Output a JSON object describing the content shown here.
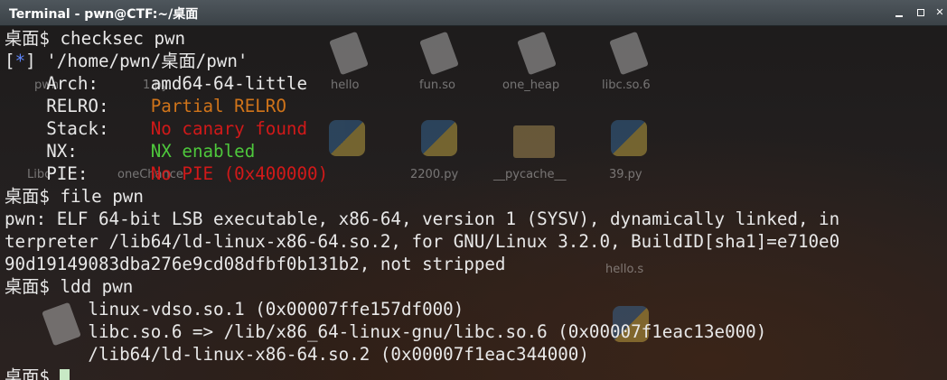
{
  "window": {
    "title": "Terminal - pwn@CTF:~/桌面"
  },
  "desktop_icons": [
    {
      "name": "pwn",
      "label": "pwn"
    },
    {
      "name": "1.py",
      "label": "1.py"
    },
    {
      "name": "hello",
      "label": "hello"
    },
    {
      "name": "fun.so",
      "label": "fun.so"
    },
    {
      "name": "one_heap",
      "label": "one_heap"
    },
    {
      "name": "libc.so.6",
      "label": "libc.so.6"
    },
    {
      "name": "libc",
      "label": "Libc"
    },
    {
      "name": "onechance",
      "label": "oneChance"
    },
    {
      "name": "2200.py",
      "label": "2200.py"
    },
    {
      "name": "pycache",
      "label": "__pycache__"
    },
    {
      "name": "39.py",
      "label": "39.py"
    },
    {
      "name": "hello.s",
      "label": "hello.s"
    }
  ],
  "terminal": {
    "lines": [
      [
        {
          "t": "桌面$ checksec pwn",
          "c": "white"
        }
      ],
      [
        {
          "t": "[",
          "c": "white"
        },
        {
          "t": "*",
          "c": "blue"
        },
        {
          "t": "] '/home/pwn/桌面/pwn'",
          "c": "white"
        }
      ],
      [
        {
          "t": "    Arch:     amd64-64-little",
          "c": "white"
        }
      ],
      [
        {
          "t": "    RELRO:    ",
          "c": "white"
        },
        {
          "t": "Partial RELRO",
          "c": "orange"
        }
      ],
      [
        {
          "t": "    Stack:    ",
          "c": "white"
        },
        {
          "t": "No canary found",
          "c": "red"
        }
      ],
      [
        {
          "t": "    NX:       ",
          "c": "white"
        },
        {
          "t": "NX enabled",
          "c": "green"
        }
      ],
      [
        {
          "t": "    PIE:      ",
          "c": "white"
        },
        {
          "t": "No PIE (0x400000)",
          "c": "red"
        }
      ],
      [
        {
          "t": "桌面$ file pwn",
          "c": "white"
        }
      ],
      [
        {
          "t": "pwn: ELF 64-bit LSB executable, x86-64, version 1 (SYSV), dynamically linked, in",
          "c": "white"
        }
      ],
      [
        {
          "t": "terpreter /lib64/ld-linux-x86-64.so.2, for GNU/Linux 3.2.0, BuildID[sha1]=e710e0",
          "c": "white"
        }
      ],
      [
        {
          "t": "90d19149083dba276e9cd08dfbf0b131b2, not stripped",
          "c": "white"
        }
      ],
      [
        {
          "t": "桌面$ ldd pwn",
          "c": "white"
        }
      ],
      [
        {
          "t": "        linux-vdso.so.1 (0x00007ffe157df000)",
          "c": "white"
        }
      ],
      [
        {
          "t": "        libc.so.6 => /lib/x86_64-linux-gnu/libc.so.6 (0x00007f1eac13e000)",
          "c": "white"
        }
      ],
      [
        {
          "t": "        /lib64/ld-linux-x86-64.so.2 (0x00007f1eac344000)",
          "c": "white"
        }
      ],
      [
        {
          "t": "桌面$ ",
          "c": "white"
        }
      ]
    ]
  },
  "colors": {
    "blue": "#5f87ff",
    "orange": "#d0741a",
    "red": "#d11919",
    "green": "#4ec83c",
    "cursor": "#c8e9c5"
  }
}
